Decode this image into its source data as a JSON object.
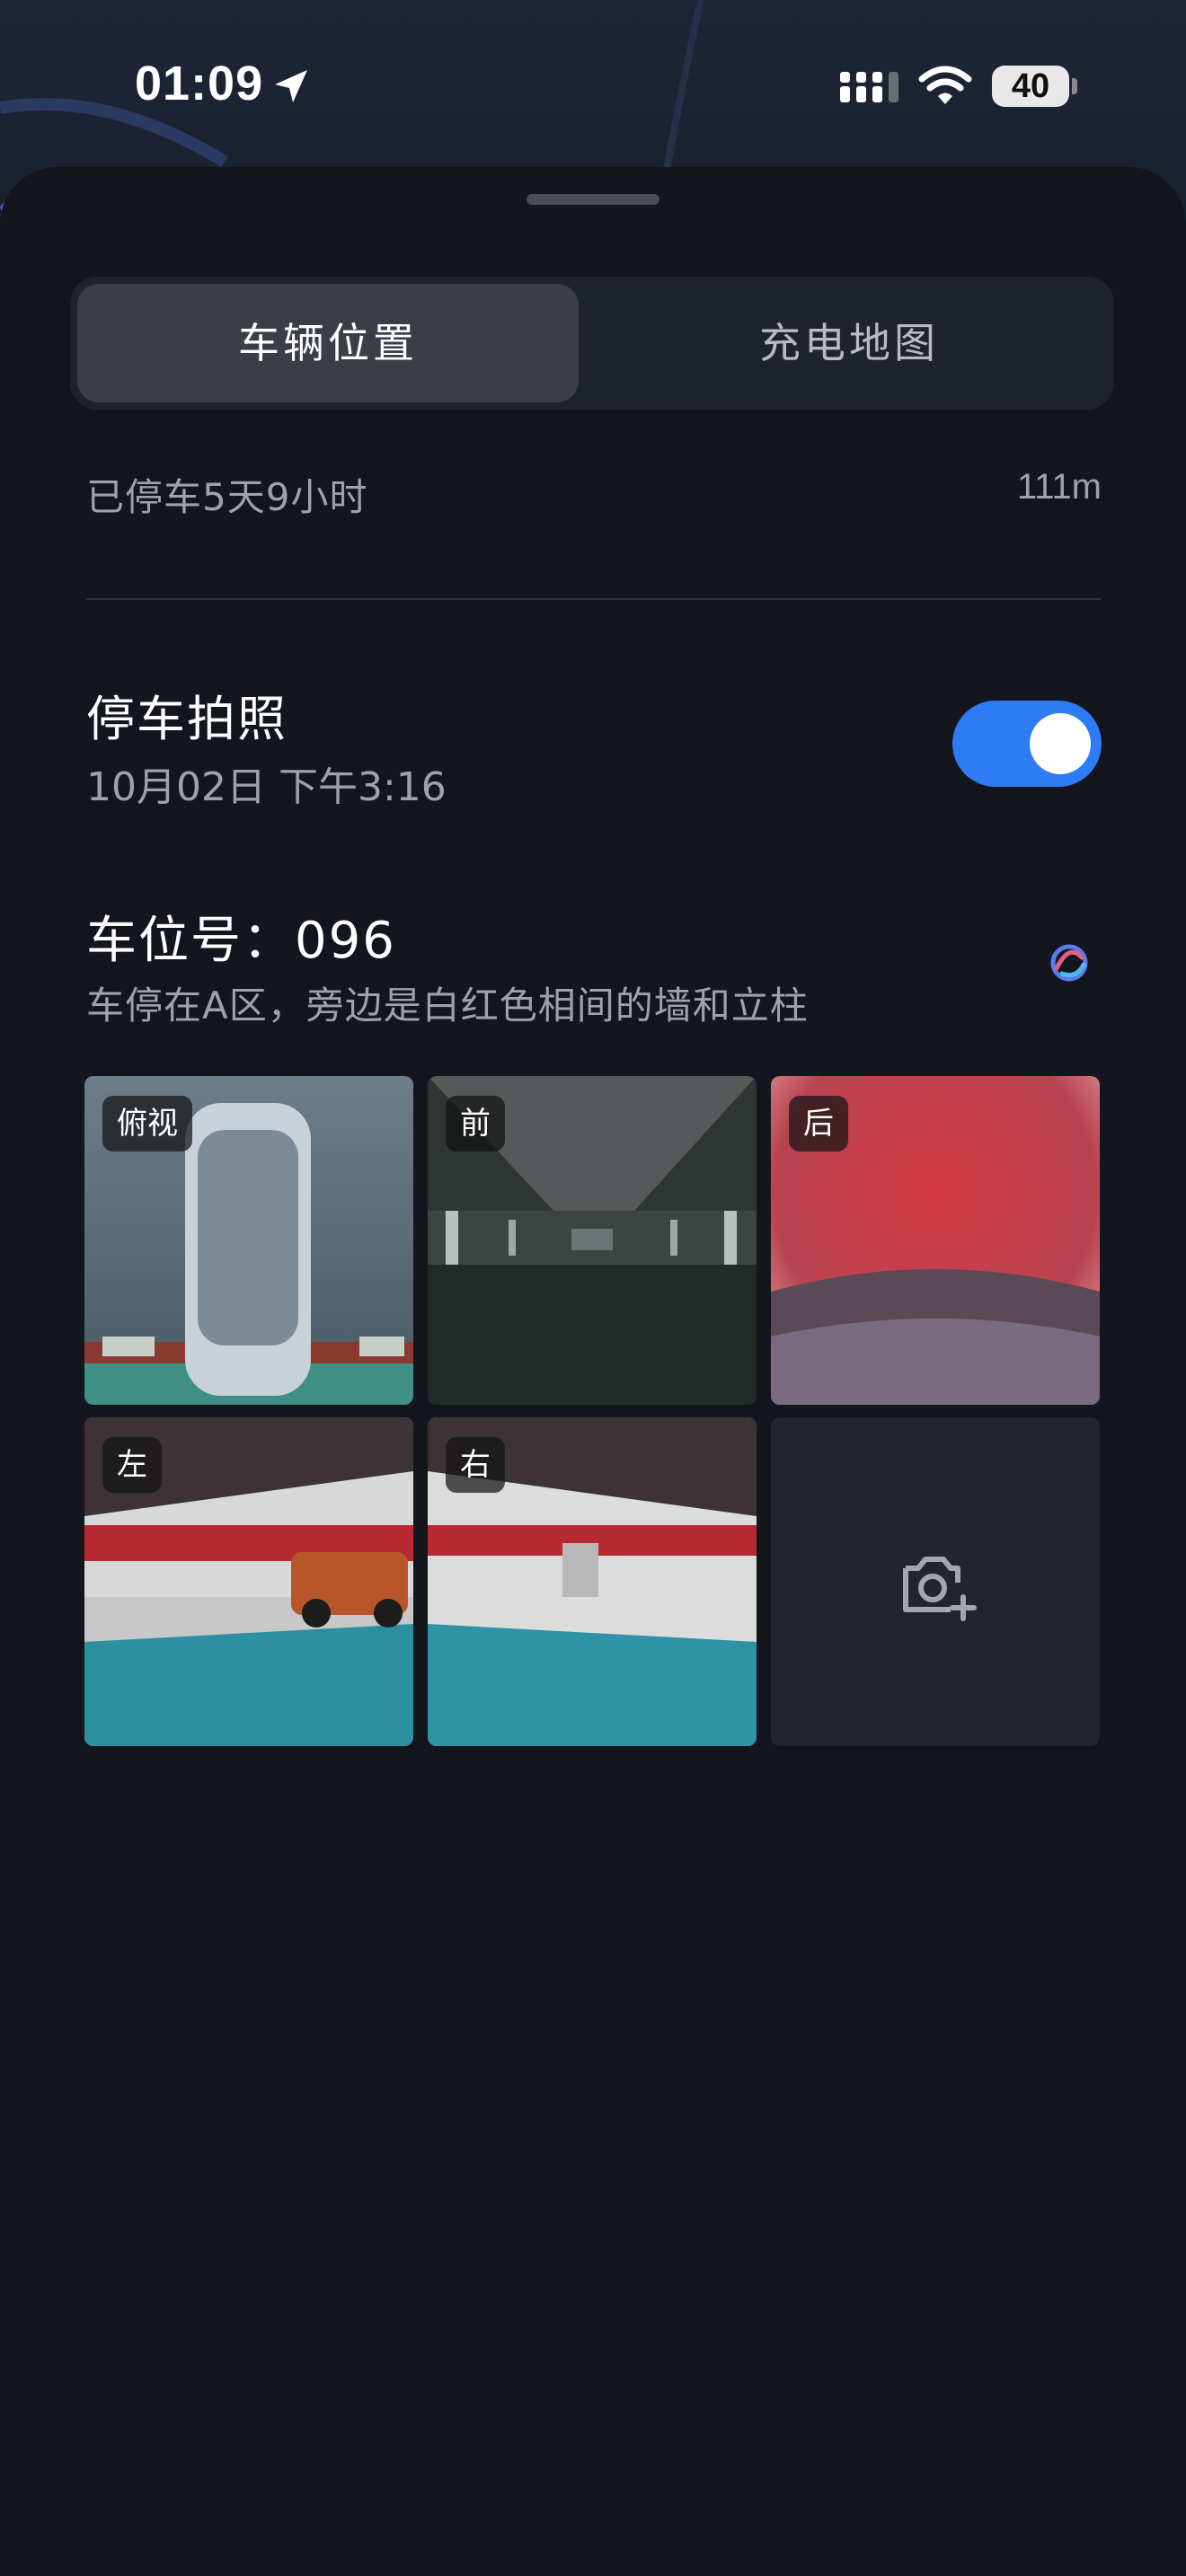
{
  "status_bar": {
    "time": "01:09",
    "battery": "40",
    "icons": [
      "location-arrow-icon",
      "signal-icon",
      "wifi-icon",
      "battery-icon"
    ]
  },
  "tabs": [
    {
      "label": "车辆位置",
      "active": true
    },
    {
      "label": "充电地图",
      "active": false
    }
  ],
  "parking": {
    "duration": "已停车5天9小时",
    "distance": "111m"
  },
  "parking_photo": {
    "title": "停车拍照",
    "timestamp": "10月02日 下午3:16",
    "enabled": true
  },
  "spot": {
    "title": "车位号：096",
    "description": "车停在A区，旁边是白红色相间的墙和立柱"
  },
  "photos": [
    {
      "label": "俯视",
      "view": "top-down"
    },
    {
      "label": "前",
      "view": "front"
    },
    {
      "label": "后",
      "view": "rear"
    },
    {
      "label": "左",
      "view": "left"
    },
    {
      "label": "右",
      "view": "right"
    }
  ],
  "add_photo": {
    "icon": "camera-add-icon"
  },
  "colors": {
    "accent": "#2e7bf6",
    "sheet_bg": "#13161d",
    "muted_text": "#9ea2a9"
  }
}
